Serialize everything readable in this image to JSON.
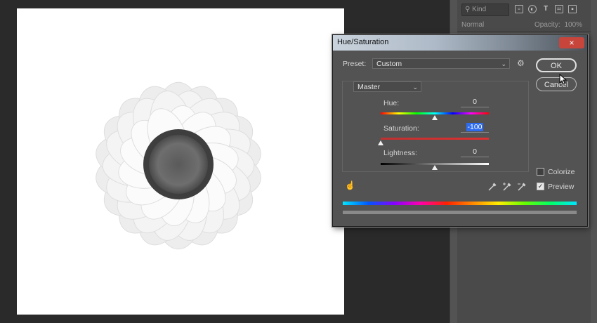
{
  "panel": {
    "search_placeholder": "Kind",
    "blend_mode": "Normal",
    "opacity_label": "Opacity:",
    "opacity_value": "100%",
    "tool_icons": [
      "image-filter-icon",
      "adjustment-filter-icon",
      "type-filter-icon",
      "shape-filter-icon",
      "smart-object-filter-icon"
    ]
  },
  "dialog": {
    "title": "Hue/Saturation",
    "close_symbol": "×",
    "preset_label": "Preset:",
    "preset_value": "Custom",
    "channel_value": "Master",
    "ok_label": "OK",
    "cancel_label": "Cancel",
    "hue": {
      "label": "Hue:",
      "value": "0"
    },
    "saturation": {
      "label": "Saturation:",
      "value": "-100"
    },
    "lightness": {
      "label": "Lightness:",
      "value": "0"
    },
    "colorize": {
      "label": "Colorize",
      "checked": false
    },
    "preview": {
      "label": "Preview",
      "checked": true
    }
  },
  "colors": {
    "dialog_bg": "#535353",
    "workspace_bg": "#2a2a2a",
    "selection_blue": "#2d6cf0",
    "close_red": "#c8453c"
  }
}
